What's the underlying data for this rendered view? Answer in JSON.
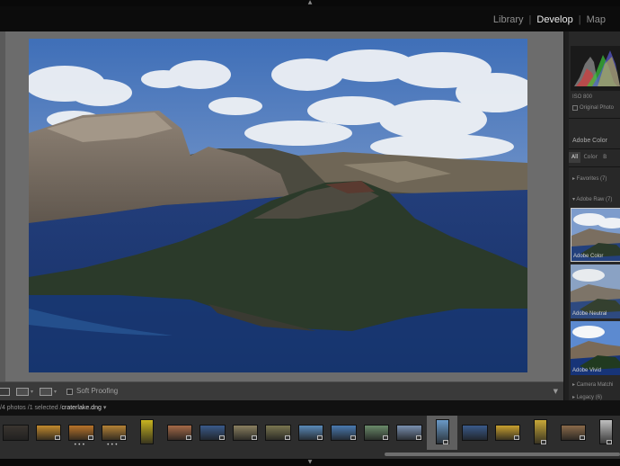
{
  "modules": {
    "items": [
      {
        "label": "Library",
        "active": false
      },
      {
        "label": "Develop",
        "active": true
      },
      {
        "label": "Map",
        "active": false
      }
    ],
    "separator": "|"
  },
  "panel": {
    "iso": "ISO 800",
    "original_photo": "Original Photo",
    "profile_browser_title": "Adobe Color",
    "filters": [
      "All",
      "Color",
      "B"
    ],
    "favorites": "Favorites (7)",
    "adobe_raw": "Adobe Raw (7)",
    "profiles": [
      "Adobe Color",
      "Adobe Neutral",
      "Adobe Vivid"
    ],
    "camera_matching": "Camera Matchi",
    "legacy": "Legacy (6)",
    "histogram_colors": [
      "#d63c3c",
      "#3cc63c",
      "#5a5ad6",
      "#c8c8c8"
    ]
  },
  "toolbar": {
    "soft_proofing_label": "Soft Proofing",
    "view_icon": "loupe-view-icon",
    "compare_icon": "before-after-icon",
    "yy_icon": "yy-compare-icon",
    "menu_icon": "chevron-down-icon"
  },
  "filmstrip": {
    "info_prefix": "/4 photos /1 selected /",
    "filename": "craterlake.dng",
    "selected_index": 13,
    "thumbs": [
      {
        "color": "#3a3530",
        "badge": false
      },
      {
        "color": "#c28a2e",
        "badge": true,
        "dots": false
      },
      {
        "color": "#b8742a",
        "badge": true,
        "dots": true
      },
      {
        "color": "#b48236",
        "badge": true,
        "dots": true
      },
      {
        "color": "#c8b420",
        "badge": false,
        "portrait": true
      },
      {
        "color": "#a56a48",
        "badge": true
      },
      {
        "color": "#3a5a8a",
        "badge": true
      },
      {
        "color": "#8a8060",
        "badge": true
      },
      {
        "color": "#7a7650",
        "badge": true
      },
      {
        "color": "#5a8ab8",
        "badge": true
      },
      {
        "color": "#4a7ab0",
        "badge": true
      },
      {
        "color": "#6a8a6a",
        "badge": true
      },
      {
        "color": "#7a90b0",
        "badge": true
      },
      {
        "color": "#6a9ac8",
        "badge": true,
        "portrait": true
      },
      {
        "color": "#3a5a8a",
        "badge": false
      },
      {
        "color": "#c8a030",
        "badge": true
      },
      {
        "color": "#c8a838",
        "badge": true,
        "portrait": true
      },
      {
        "color": "#8a6a4a",
        "badge": true
      },
      {
        "color": "#c0c0c0",
        "badge": true,
        "portrait": true
      }
    ]
  }
}
